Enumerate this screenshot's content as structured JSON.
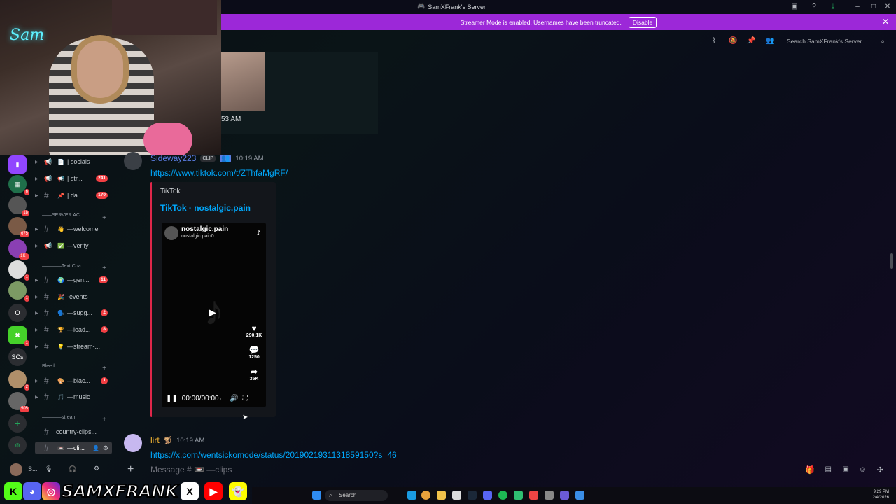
{
  "window": {
    "title": "SamXFrank's Server"
  },
  "streamer_bar": {
    "text": "Streamer Mode is enabled. Usernames have been truncated.",
    "button": "Disable"
  },
  "header": {
    "search_placeholder": "Search SamXFrank's Server"
  },
  "rail": {
    "badges": [
      "6",
      "18",
      "675",
      "1K+",
      "1",
      "1",
      "1",
      "2",
      "505"
    ],
    "labels": [
      "O",
      "SCs"
    ]
  },
  "channels": {
    "items": [
      {
        "emoji": "📄",
        "label": "| socials",
        "badge": ""
      },
      {
        "emoji": "📢",
        "label": "| str...",
        "badge": "241"
      },
      {
        "emoji": "📌",
        "label": "| da...",
        "badge": "170"
      },
      {
        "emoji": "👋",
        "label": "—welcome",
        "badge": ""
      },
      {
        "emoji": "✅",
        "label": "—verify",
        "badge": ""
      },
      {
        "emoji": "🌍",
        "label": "—gen...",
        "badge": "11"
      },
      {
        "emoji": "🎉",
        "label": "-events",
        "badge": ""
      },
      {
        "emoji": "🗣️",
        "label": "—sugg...",
        "badge": "2"
      },
      {
        "emoji": "🏆",
        "label": "—lead...",
        "badge": "8"
      },
      {
        "emoji": "💡",
        "label": "—stream-...",
        "badge": ""
      },
      {
        "emoji": "🎨",
        "label": "—blac...",
        "badge": "1"
      },
      {
        "emoji": "🎵",
        "label": "—music",
        "badge": ""
      },
      {
        "emoji": "",
        "label": "country-clips...",
        "badge": ""
      },
      {
        "emoji": "📼",
        "label": "—cli...",
        "badge": ""
      }
    ],
    "categories": [
      "——SERVER AC...",
      "————Text Cha...",
      "Bleed",
      "————stream"
    ]
  },
  "user_panel": {
    "name": "S..."
  },
  "messages": {
    "top_time": "53 AM",
    "msg1": {
      "username": "Sideway223",
      "tag": "CLIP",
      "time": "10:19 AM",
      "link": "https://www.tiktok.com/t/ZThfaMgRF/"
    },
    "embed": {
      "provider": "TikTok",
      "title": "TikTok · nostalgic.pain",
      "account": "nostalgic.pain",
      "account_sub": "nostalgic.pain0",
      "likes": "290.1K",
      "comments": "1250",
      "shares": "35K",
      "time": "00:00/00:00"
    },
    "msg2": {
      "username": "lirt",
      "time": "10:19 AM",
      "link": "https://x.com/wentsickomode/status/2019021931131859150?s=46"
    }
  },
  "composer": {
    "placeholder": "Message # 📼 —clips"
  },
  "banner": {
    "text": "SAMXFRANK"
  },
  "taskbar": {
    "search": "Search",
    "time": "9:29 PM",
    "date": "2/4/2026"
  }
}
